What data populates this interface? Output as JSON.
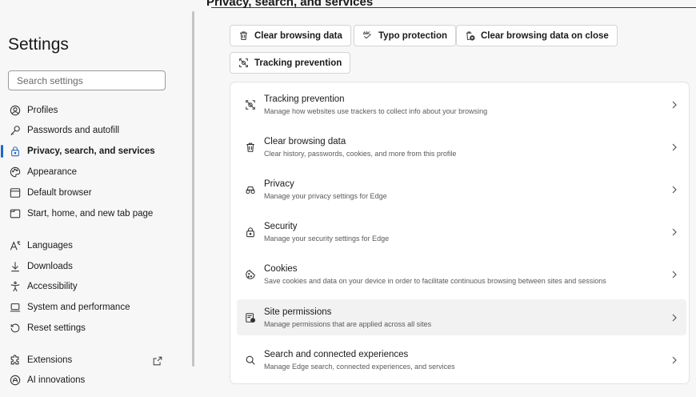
{
  "sidebar": {
    "title": "Settings",
    "search_placeholder": "Search settings",
    "items": [
      {
        "label": "Profiles",
        "icon": "profile-icon"
      },
      {
        "label": "Passwords and autofill",
        "icon": "key-icon"
      },
      {
        "label": "Privacy, search, and services",
        "icon": "lock-icon",
        "active": true
      },
      {
        "label": "Appearance",
        "icon": "palette-icon"
      },
      {
        "label": "Default browser",
        "icon": "browser-icon"
      },
      {
        "label": "Start, home, and new tab page",
        "icon": "home-tab-icon"
      },
      {
        "label": "Languages",
        "icon": "language-icon"
      },
      {
        "label": "Downloads",
        "icon": "download-icon"
      },
      {
        "label": "Accessibility",
        "icon": "accessibility-icon"
      },
      {
        "label": "System and performance",
        "icon": "laptop-icon"
      },
      {
        "label": "Reset settings",
        "icon": "reset-icon"
      },
      {
        "label": "Extensions",
        "icon": "puzzle-icon"
      },
      {
        "label": "AI innovations",
        "icon": "ai-icon"
      }
    ],
    "accent_color": "#2166c7"
  },
  "main": {
    "heading": "Privacy, search, and services",
    "chips": [
      {
        "label": "Clear browsing data",
        "icon": "trash-icon"
      },
      {
        "label": "Typo protection",
        "icon": "abc-check-icon"
      },
      {
        "label": "Clear browsing data on close",
        "icon": "trash-close-icon"
      },
      {
        "label": "Tracking prevention",
        "icon": "tracking-icon"
      }
    ],
    "rows": [
      {
        "title": "Tracking prevention",
        "desc": "Manage how websites use trackers to collect info about your browsing",
        "icon": "tracking-icon"
      },
      {
        "title": "Clear browsing data",
        "desc": "Clear history, passwords, cookies, and more from this profile",
        "icon": "trash-icon"
      },
      {
        "title": "Privacy",
        "desc": "Manage your privacy settings for Edge",
        "icon": "glasses-icon"
      },
      {
        "title": "Security",
        "desc": "Manage your security settings for Edge",
        "icon": "lock-icon"
      },
      {
        "title": "Cookies",
        "desc": "Save cookies and data on your device in order to facilitate continuous browsing between sites and sessions",
        "icon": "cookie-icon"
      },
      {
        "title": "Site permissions",
        "desc": "Manage permissions that are applied across all sites",
        "icon": "site-permissions-icon"
      },
      {
        "title": "Search and connected experiences",
        "desc": "Manage Edge search, connected experiences, and services",
        "icon": "search-icon"
      }
    ]
  }
}
